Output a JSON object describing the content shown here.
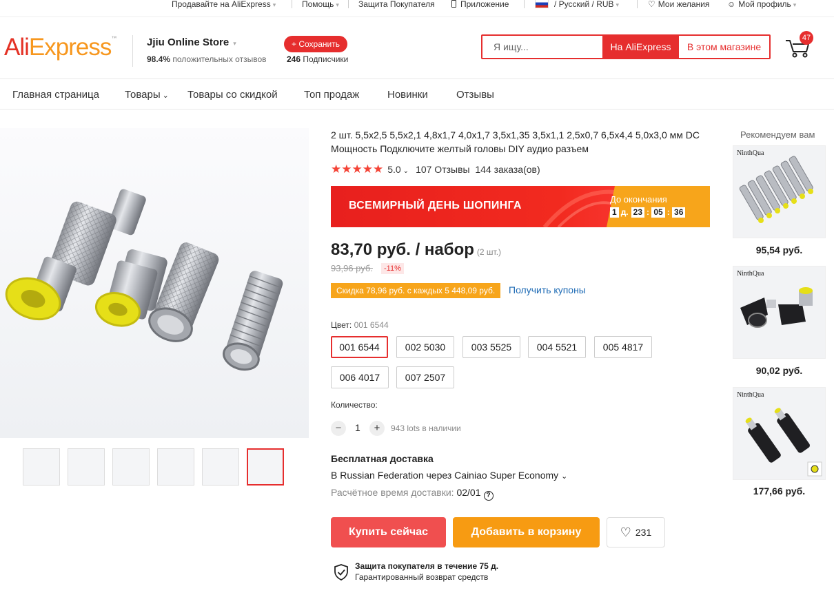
{
  "topbar": {
    "sell": "Продавайте на AliExpress",
    "help": "Помощь",
    "protection": "Защита Покупателя",
    "app": "Приложение",
    "locale": "/ Русский / RUB",
    "wishlist": "Мои желания",
    "profile": "Мой профиль"
  },
  "header": {
    "logo": "AliExpress",
    "store_name": "Jjiu Online Store",
    "store_rating_value": "98.4%",
    "store_rating_label": "положительных отзывов",
    "follow_label": "+ Сохранить",
    "followers_count": "246",
    "followers_label": "Подписчики",
    "search_placeholder": "Я ищу...",
    "search_aliexpress": "На AliExpress",
    "search_store": "В этом магазине",
    "cart_count": "47"
  },
  "nav": {
    "items": [
      "Главная страница",
      "Товары",
      "Товары со скидкой",
      "Топ продаж",
      "Новинки",
      "Отзывы"
    ]
  },
  "product": {
    "title": "2 шт. 5,5x2,5 5,5x2,1 4,8x1,7 4,0x1,7 3,5x1,35 3,5x1,1 2,5x0,7 6,5x4,4 5,0x3,0 мм DC Мощность Подключите желтый головы DIY аудио разъем",
    "stars": "★★★★★",
    "rating": "5.0",
    "reviews": "107 Отзывы",
    "orders": "144 заказа(ов)",
    "banner_text": "ВСЕМИРНЫЙ ДЕНЬ ШОПИНГА",
    "banner_until": "До окончания",
    "timer": {
      "days": "1",
      "days_label": "д.",
      "hours": "23",
      "minutes": "05",
      "seconds": "36"
    },
    "price": "83,70 руб. / набор",
    "price_unit": "(2 шт.)",
    "old_price": "93,96 руб.",
    "discount": "-11%",
    "coupon": "Скидка 78,96 руб. с каждых 5 448,09 руб.",
    "coupon_link": "Получить купоны",
    "color_label": "Цвет:",
    "color_selected": "001 6544",
    "colors": [
      "001 6544",
      "002 5030",
      "003 5525",
      "004 5521",
      "005 4817",
      "006 4017",
      "007 2507"
    ],
    "qty_label": "Количество:",
    "qty": "1",
    "stock": "943 lots в наличии",
    "ship_title": "Бесплатная доставка",
    "ship_method": "В Russian Federation через Cainiao Super Economy",
    "ship_eta_label": "Расчётное время доставки:",
    "ship_eta_value": "02/01",
    "buy_now": "Купить сейчас",
    "add_to_cart": "Добавить в корзину",
    "wish_count": "231",
    "protect_title": "Защита покупателя в течение 75 д.",
    "protect_sub": "Гарантированный возврат средств"
  },
  "recommend": {
    "title": "Рекомендуем вам",
    "brand": "NinthQua",
    "prices": [
      "95,54 руб.",
      "90,02 руб.",
      "177,66 руб."
    ]
  },
  "colors": {
    "accent": "#e62e2e",
    "orange": "#f79b12",
    "link": "#1e6bb5"
  }
}
